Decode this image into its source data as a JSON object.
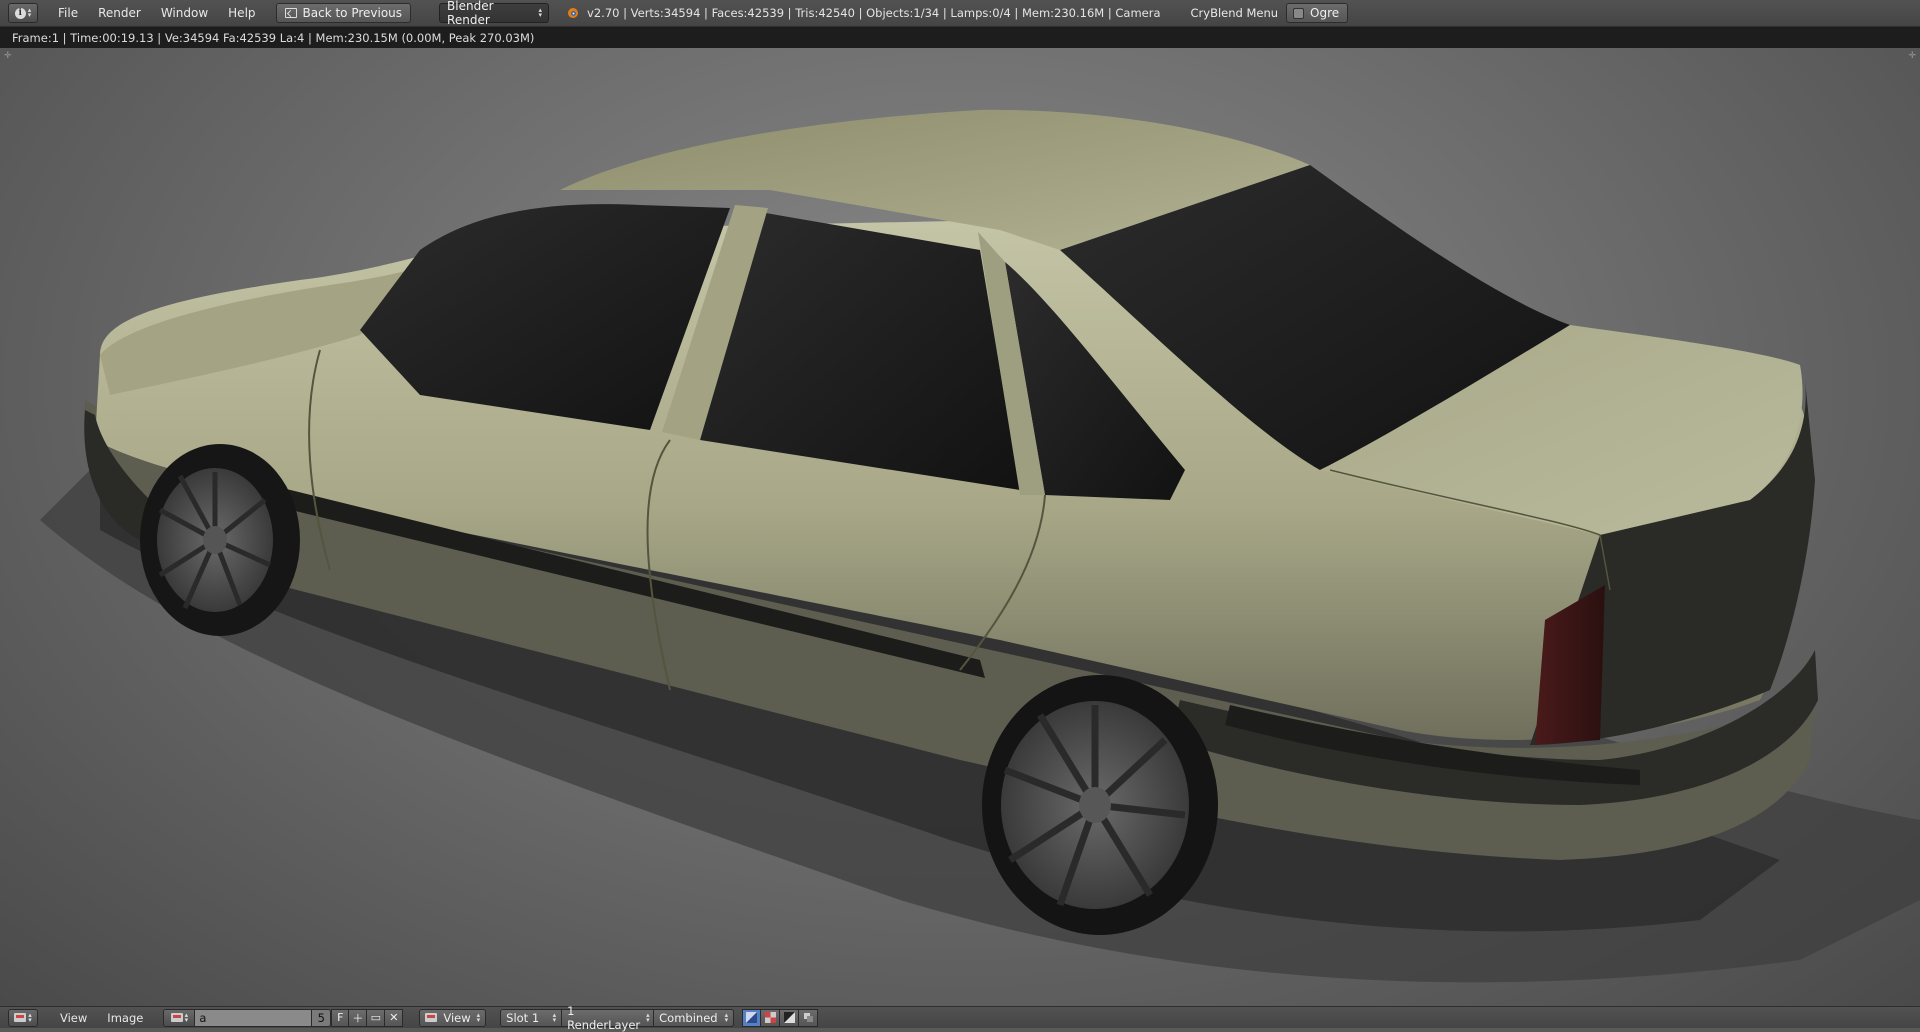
{
  "topbar": {
    "menus": [
      "File",
      "Render",
      "Window",
      "Help"
    ],
    "back_label": "Back to Previous",
    "engine": "Blender Render",
    "stats": "v2.70 | Verts:34594 | Faces:42539 | Tris:42540 | Objects:1/34 | Lamps:0/4 | Mem:230.16M | Camera",
    "cry_menu": "CryBlend Menu",
    "ogre_label": "Ogre"
  },
  "render_info": "Frame:1 | Time:00:19.13 | Ve:34594 Fa:42539 La:4 | Mem:230.15M (0.00M, Peak 270.03M)",
  "bottombar": {
    "menus": [
      "View",
      "Image"
    ],
    "image_name": "a",
    "users": "5",
    "fake_user": "F",
    "view_label": "View",
    "slot": "Slot 1",
    "render_layer": "1 RenderLayer",
    "pass": "Combined"
  },
  "colors": {
    "car_body": "#b8b898",
    "glass": "#1e1e1e",
    "accent": "#5680c2"
  }
}
